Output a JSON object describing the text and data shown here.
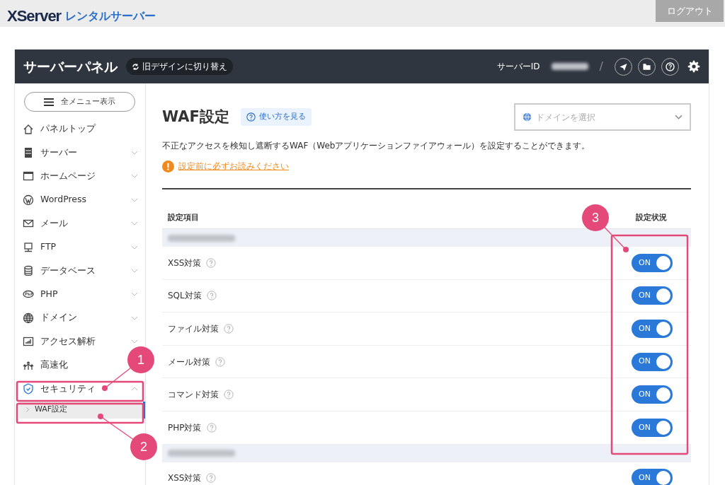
{
  "header": {
    "logo_mark": "XServer",
    "logo_subtitle": "レンタルサーバー",
    "logout_button": "ログアウト"
  },
  "panel": {
    "title": "サーバーパネル",
    "switch_button": "旧デザインに切り替え",
    "server_id_label": "サーバーID",
    "separator": "/"
  },
  "sidebar": {
    "menu_button": "全メニュー表示",
    "items": [
      {
        "kind": "home",
        "label": "パネルトップ",
        "selected": false
      },
      {
        "kind": "server",
        "label": "サーバー",
        "has_submenu": true,
        "expanded": false,
        "selected": false
      },
      {
        "kind": "browser",
        "label": "ホームページ",
        "has_submenu": true,
        "expanded": false,
        "selected": false
      },
      {
        "kind": "wordpress",
        "label": "WordPress",
        "has_submenu": true,
        "expanded": false,
        "selected": false
      },
      {
        "kind": "mail",
        "label": "メール",
        "has_submenu": true,
        "expanded": false,
        "selected": false
      },
      {
        "kind": "monitor",
        "label": "FTP",
        "has_submenu": true,
        "expanded": false,
        "selected": false
      },
      {
        "kind": "database",
        "label": "データベース",
        "has_submenu": true,
        "expanded": false,
        "selected": false
      },
      {
        "kind": "php",
        "label": "PHP",
        "has_submenu": true,
        "expanded": false,
        "selected": false
      },
      {
        "kind": "globe",
        "label": "ドメイン",
        "has_submenu": true,
        "expanded": false,
        "selected": false
      },
      {
        "kind": "chart",
        "label": "アクセス解析",
        "has_submenu": true,
        "expanded": false,
        "selected": false
      },
      {
        "kind": "speed",
        "label": "高速化",
        "selected": false
      },
      {
        "kind": "shield",
        "label": "セキュリティ",
        "has_submenu": true,
        "expanded": true,
        "selected": true,
        "children": [
          {
            "label": "WAF設定",
            "selected": true
          }
        ]
      }
    ]
  },
  "page": {
    "title": "WAF設定",
    "help_button": "使い方を見る",
    "domain_select": {
      "placeholder": "ドメインを選択"
    },
    "description": "不正なアクセスを検知し遮断するWAF（Webアプリケーションファイアウォール）を設定することができます。",
    "warning_link": "設定前に必ずお読みください"
  },
  "table": {
    "columns": [
      "設定項目",
      "設定状況"
    ],
    "groups": [
      {
        "rows": [
          {
            "label": "XSS対策",
            "on": true,
            "toggle_text": "ON"
          },
          {
            "label": "SQL対策",
            "on": true,
            "toggle_text": "ON"
          },
          {
            "label": "ファイル対策",
            "on": true,
            "toggle_text": "ON"
          },
          {
            "label": "メール対策",
            "on": true,
            "toggle_text": "ON"
          },
          {
            "label": "コマンド対策",
            "on": true,
            "toggle_text": "ON"
          },
          {
            "label": "PHP対策",
            "on": true,
            "toggle_text": "ON"
          }
        ]
      },
      {
        "rows": [
          {
            "label": "XSS対策",
            "on": true,
            "toggle_text": "ON"
          }
        ]
      }
    ]
  },
  "annotations": [
    {
      "number": "1"
    },
    {
      "number": "2"
    },
    {
      "number": "3"
    }
  ]
}
